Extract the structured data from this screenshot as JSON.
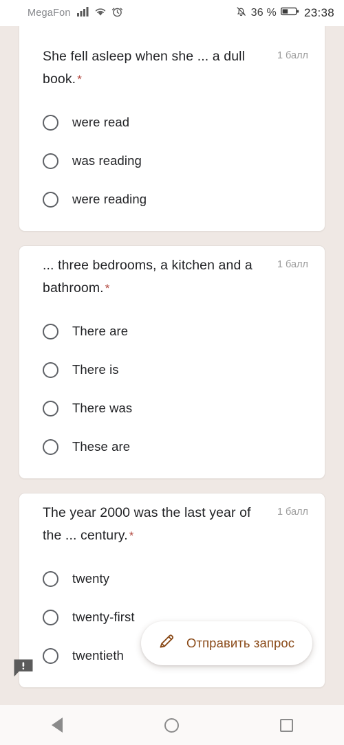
{
  "status_bar": {
    "carrier": "MegaFon",
    "signal_icon": "cellular-signal-icon",
    "wifi_icon": "wifi-icon",
    "alarm_icon": "alarm-clock-icon",
    "mute_icon": "bell-off-icon",
    "battery_percent": "36 %",
    "battery_icon": "battery-icon",
    "time": "23:38"
  },
  "colors": {
    "page_background": "#efe8e4",
    "card_background": "#ffffff",
    "required_star": "#b34b42",
    "accent_brown": "#8a4a18",
    "points_gray": "#9b9b9b"
  },
  "form": {
    "questions": [
      {
        "text": "She fell asleep when she ... a dull book.",
        "required_marker": "*",
        "points": "1 балл",
        "options": [
          "were read",
          "was reading",
          "were reading"
        ]
      },
      {
        "text": "... three bedrooms, a kitchen and a bathroom.",
        "required_marker": "*",
        "points": "1 балл",
        "options": [
          "There are",
          "There is",
          "There was",
          "These are"
        ]
      },
      {
        "text": "The year 2000 was the last year of the ... century.",
        "required_marker": "*",
        "points": "1 балл",
        "options": [
          "twenty",
          "twenty-first",
          "twentieth"
        ]
      }
    ]
  },
  "floating_action": {
    "label": "Отправить запрос",
    "icon": "pencil-icon"
  },
  "feedback_tab": {
    "icon": "feedback-bubble-icon"
  },
  "navigation_bar": {
    "back": "back-triangle-icon",
    "home": "home-circle-icon",
    "recents": "recents-square-icon"
  }
}
